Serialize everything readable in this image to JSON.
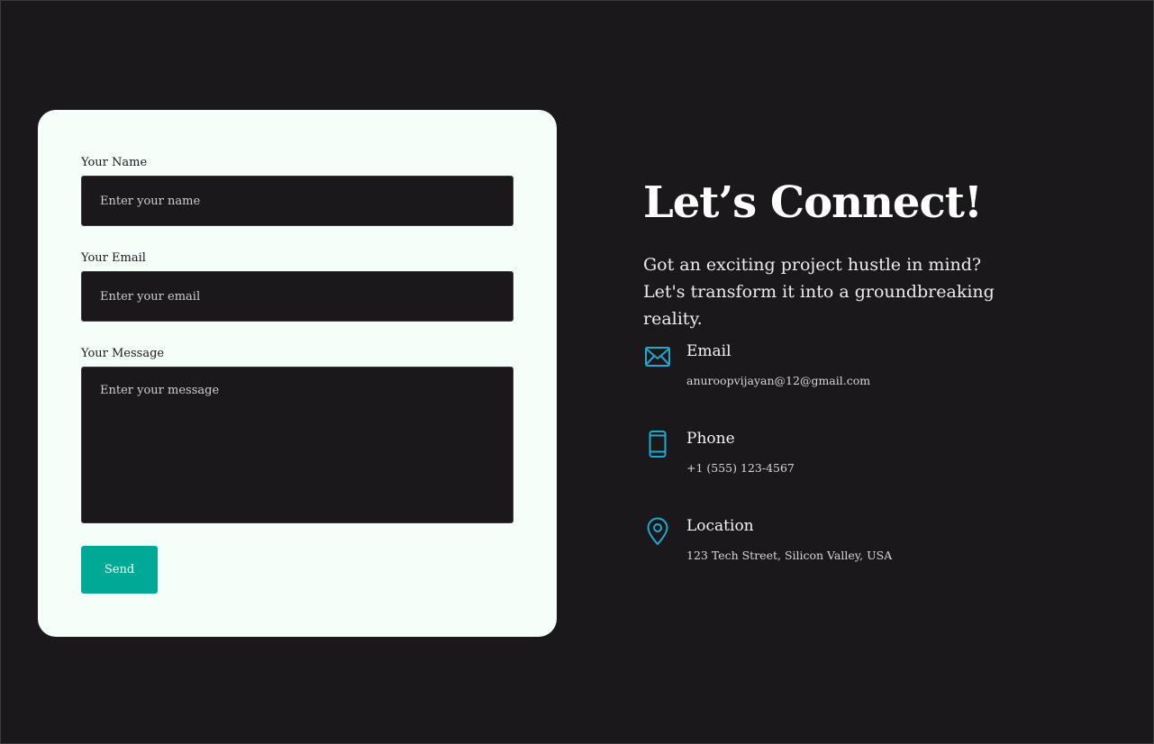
{
  "form": {
    "name": {
      "label": "Your Name",
      "placeholder": "Enter your name"
    },
    "email": {
      "label": "Your Email",
      "placeholder": "Enter your email"
    },
    "message": {
      "label": "Your Message",
      "placeholder": "Enter your message"
    },
    "send_label": "Send"
  },
  "info": {
    "heading": "Let’s Connect!",
    "subtext": "Got an exciting project hustle in mind? Let's transform it into a groundbreaking reality.",
    "items": [
      {
        "icon": "envelope-icon",
        "title": "Email",
        "value": "anuroopvijayan@12@gmail.com"
      },
      {
        "icon": "phone-icon",
        "title": "Phone",
        "value": "+1 (555) 123-4567"
      },
      {
        "icon": "location-pin-icon",
        "title": "Location",
        "value": "123 Tech Street, Silicon Valley, USA"
      }
    ]
  },
  "colors": {
    "background": "#1a181b",
    "card": "#f5fff9",
    "accent": "#00a896",
    "icon": "#1fa9cc"
  }
}
